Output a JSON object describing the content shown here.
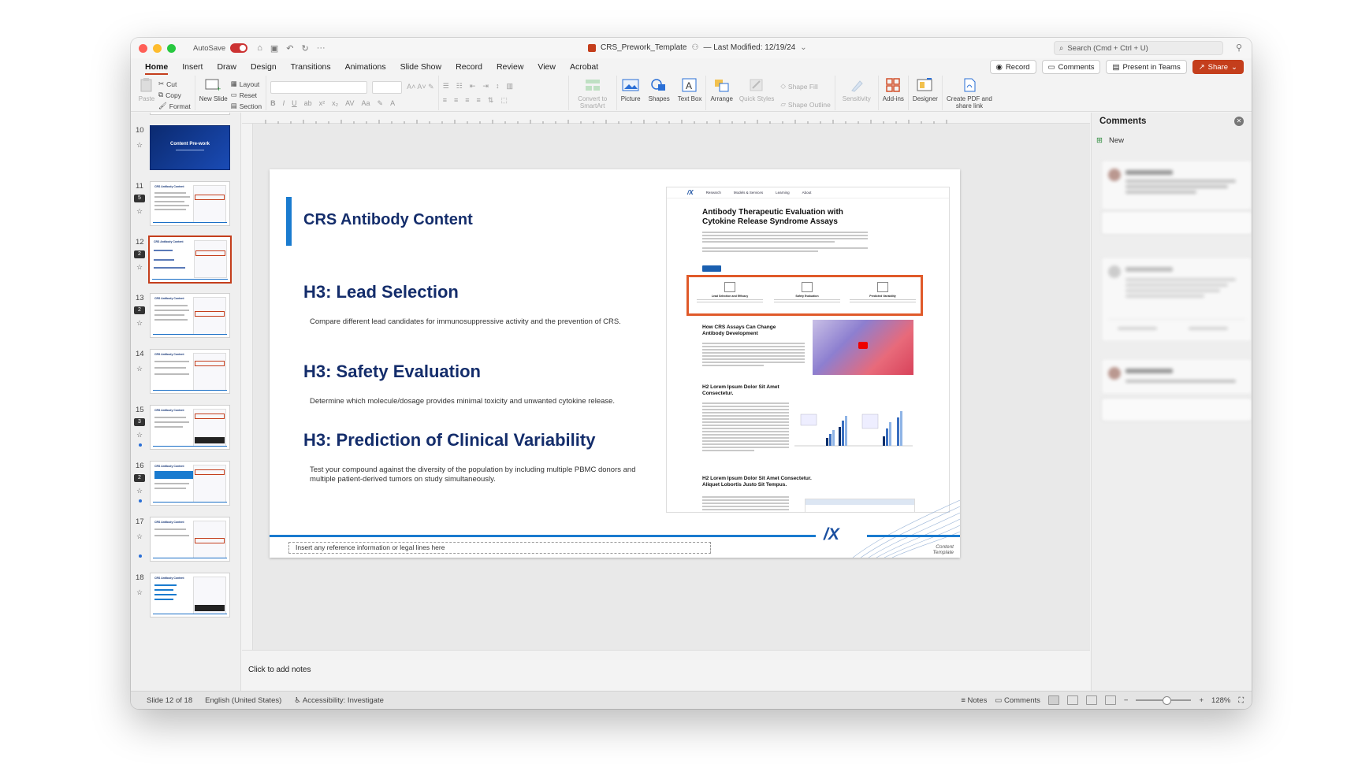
{
  "titlebar": {
    "autosave_label": "AutoSave",
    "doc_title": "CRS_Prework_Template",
    "modified": "— Last Modified: 12/19/24",
    "search_placeholder": "Search (Cmd + Ctrl + U)"
  },
  "menu": {
    "tabs": [
      "Home",
      "Insert",
      "Draw",
      "Design",
      "Transitions",
      "Animations",
      "Slide Show",
      "Record",
      "Review",
      "View",
      "Acrobat"
    ],
    "record": "Record",
    "comments": "Comments",
    "present": "Present in Teams",
    "share": "Share"
  },
  "ribbon": {
    "paste": "Paste",
    "cut": "Cut",
    "copy": "Copy",
    "format": "Format",
    "new_slide": "New Slide",
    "layout": "Layout",
    "reset": "Reset",
    "section": "Section",
    "convert": "Convert to SmartArt",
    "picture": "Picture",
    "shapes": "Shapes",
    "textbox": "Text Box",
    "arrange": "Arrange",
    "quick_styles": "Quick Styles",
    "shape_fill": "Shape Fill",
    "shape_outline": "Shape Outline",
    "sensitivity": "Sensitivity",
    "addins": "Add-ins",
    "designer": "Designer",
    "create_pdf": "Create PDF and share link"
  },
  "slides_panel": {
    "thumbs": [
      {
        "num": "10",
        "title": "Content Pre-work"
      },
      {
        "num": "11",
        "title": "CRS Antibody Content",
        "badge": "5"
      },
      {
        "num": "12",
        "title": "CRS Antibody Content",
        "badge": "2"
      },
      {
        "num": "13",
        "title": "CRS Antibody Content",
        "badge": "2"
      },
      {
        "num": "14",
        "title": "CRS Antibody Content"
      },
      {
        "num": "15",
        "title": "CRS Antibody Content",
        "badge": "3"
      },
      {
        "num": "16",
        "title": "CRS Antibody Content",
        "badge": "2"
      },
      {
        "num": "17",
        "title": "CRS Antibody Content"
      },
      {
        "num": "18",
        "title": "CRS Antibody Content"
      }
    ]
  },
  "slide": {
    "title": "CRS Antibody Content",
    "h3_1": "H3: Lead Selection",
    "body_1": "Compare different lead candidates for immunosuppressive activity and the prevention of CRS.",
    "h3_2": "H3: Safety Evaluation",
    "body_2": "Determine which molecule/dosage provides minimal toxicity and unwanted cytokine release.",
    "h3_3": "H3: Prediction of Clinical Variability",
    "body_3": "Test your compound against the diversity of the population by including multiple PBMC donors and multiple patient-derived tumors on study simultaneously.",
    "reference": "Insert any reference information or legal lines here",
    "footer_label": "Content Template",
    "logo": "/X"
  },
  "embedded_page": {
    "nav": [
      "Research",
      "Models & Services",
      "Learning",
      "About"
    ],
    "h1": "Antibody Therapeutic Evaluation with Cytokine Release Syndrome Assays",
    "col1": "Lead Selection and Efficacy",
    "col2": "Safety Evaluation",
    "col3": "Predicted Variability",
    "h2_a": "How CRS Assays Can Change Antibody Development",
    "h2_b": "H2 Lorem Ipsum Dolor Sit Amet Consectetur.",
    "h2_c": "H2 Lorem Ipsum Dolor Sit Amet Consectetur. Aliquet Lobortis Justo Sit Tempus."
  },
  "comments_panel": {
    "title": "Comments",
    "new": "New"
  },
  "notes": {
    "placeholder": "Click to add notes"
  },
  "status": {
    "slide": "Slide 12 of 18",
    "language": "English (United States)",
    "accessibility": "Accessibility: Investigate",
    "notes": "Notes",
    "comments": "Comments",
    "zoom": "128%"
  }
}
